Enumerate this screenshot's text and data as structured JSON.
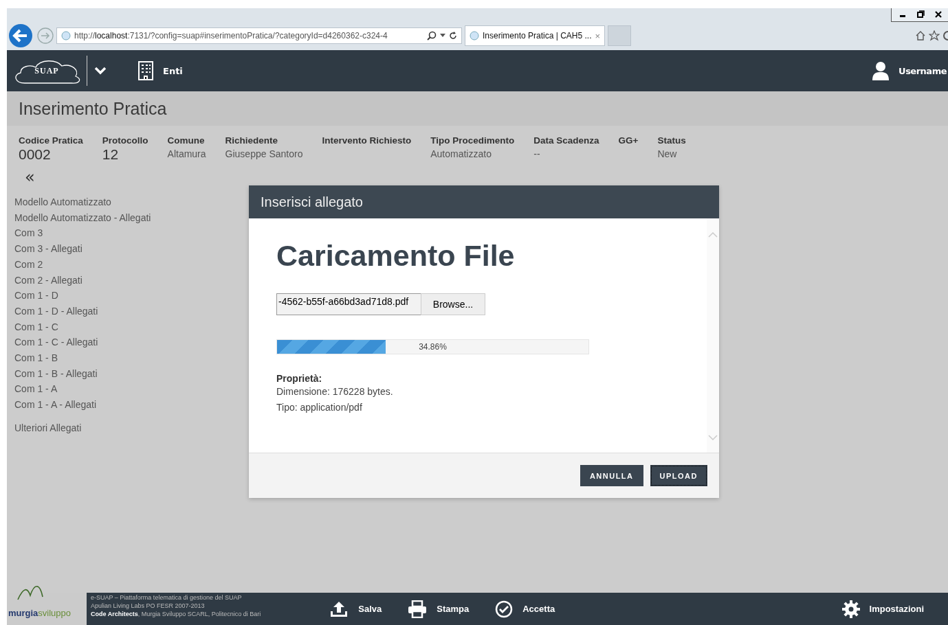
{
  "browser": {
    "address": "http://**localhost**:7131/?config=suap#inserimentoPratica/?categoryId=d4260362-c324-4",
    "tab_title": "Inserimento Pratica | CAH5 ...",
    "tab_close": "×"
  },
  "app_header": {
    "logo": "SUAP",
    "menu": "Enti",
    "user": "Username"
  },
  "page_title": "Inserimento Pratica",
  "summary": [
    {
      "label": "Codice Pratica",
      "value": "0002",
      "kind": "large"
    },
    {
      "label": "Protocollo",
      "value": "12",
      "kind": "large"
    },
    {
      "label": "Comune",
      "value": "Altamura",
      "kind": "small"
    },
    {
      "label": "Richiedente",
      "value": "Giuseppe Santoro",
      "kind": "small"
    },
    {
      "label": "Intervento Richiesto"
    },
    {
      "label": "Tipo Procedimento",
      "value": "Automatizzato",
      "kind": "small"
    },
    {
      "label": "Data Scadenza",
      "value": "--",
      "kind": "small"
    },
    {
      "label": "GG+"
    },
    {
      "label": "Status",
      "value": "New",
      "kind": "small"
    }
  ],
  "collapse": "«",
  "sidebar": {
    "items": [
      "Modello Automatizzato",
      "Modello Automatizzato - Allegati",
      "Com 3",
      "Com 3 - Allegati",
      "Com 2",
      "Com 2 - Allegati",
      "Com 1 - D",
      "Com 1 - D - Allegati",
      "Com 1 - C",
      "Com 1 - C - Allegati",
      "Com 1 - B",
      "Com 1 - B - Allegati",
      "Com 1 - A",
      "Com 1 - A - Allegati"
    ],
    "extra": "Ulteriori Allegati"
  },
  "modal": {
    "title": "Inserisci allegato",
    "heading": "Caricamento File",
    "file_value": "-4562-b55f-a66bd3ad71d8.pdf",
    "browse": "Browse...",
    "progress": {
      "level": 0.3486,
      "reading": "34.86%"
    },
    "properties_heading": "Proprietà:",
    "properties": [
      "Dimensione: 176228 bytes.",
      "Tipo: application/pdf"
    ],
    "buttons": [
      "ANNULLA",
      "UPLOAD"
    ]
  },
  "footer": {
    "logo": [
      "murgia",
      "sviluppo"
    ],
    "credits": [
      "e-SUAP – Piattaforma telematica di gestione del SUAP",
      "Apulian Living Labs PO FESR 2007-2013",
      "**Code Architects**, Murgia Sviluppo SCARL, Politecnico di Bari"
    ],
    "actions": [
      {
        "label": "Salva",
        "kind": "upload"
      },
      {
        "label": "Stampa",
        "kind": "print"
      },
      {
        "label": "Accetta",
        "kind": "check"
      }
    ],
    "settings": "Impostazioni"
  }
}
